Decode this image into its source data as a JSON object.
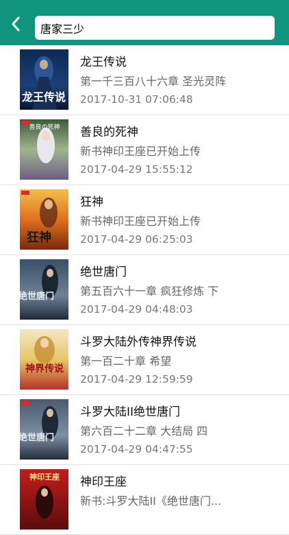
{
  "header": {
    "search_value": "唐家三少",
    "back_icon": "chevron-left-icon",
    "accent": "#12957f"
  },
  "books": [
    {
      "title": "龙王传说",
      "chapter": "第一千三百八十六章 圣光灵阵",
      "time": "2017-10-31 07:06:48",
      "cover_text": "龙王传说"
    },
    {
      "title": "善良的死神",
      "chapter": "新书神印王座已开始上传",
      "time": "2017-04-29 15:55:12",
      "cover_text": "善良の死神"
    },
    {
      "title": "狂神",
      "chapter": "新书神印王座已开始上传",
      "time": "2017-04-29 06:25:03",
      "cover_text": "狂神"
    },
    {
      "title": "绝世唐门",
      "chapter": "第五百六十一章 疯狂修炼 下",
      "time": "2017-04-29 04:48:03",
      "cover_text": "绝世唐门"
    },
    {
      "title": "斗罗大陆外传神界传说",
      "chapter": "第一百二十章 希望",
      "time": "2017-04-29 12:59:59",
      "cover_text": "神界传说"
    },
    {
      "title": "斗罗大陆II绝世唐门",
      "chapter": "第六百二十二章 大结局 四",
      "time": "2017-04-29 04:47:55",
      "cover_text": "绝世唐门"
    },
    {
      "title": "神印王座",
      "chapter": "新书:斗罗大陆II《绝世唐门...",
      "time": "",
      "cover_text": "神印王座"
    }
  ]
}
